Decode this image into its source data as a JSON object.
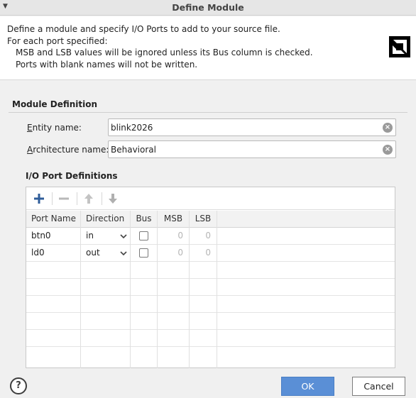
{
  "window": {
    "title": "Define Module"
  },
  "header": {
    "line1": "Define a module and specify I/O Ports to add to your source file.",
    "line2": "For each port specified:",
    "line3": "MSB and LSB values will be ignored unless its Bus column is checked.",
    "line4": "Ports with blank names will not be written.",
    "logo_icon": "amd-logo-icon"
  },
  "module_definition": {
    "section_title": "Module Definition",
    "entity_label_mnemonic": "E",
    "entity_label_rest": "ntity name:",
    "entity_value": "blink2026",
    "arch_label_mnemonic": "A",
    "arch_label_rest": "rchitecture name:",
    "arch_value": "Behavioral"
  },
  "io_ports": {
    "section_title": "I/O Port Definitions",
    "toolbar": {
      "add_icon": "plus-icon",
      "remove_icon": "minus-icon",
      "move_up_icon": "arrow-up-icon",
      "move_down_icon": "arrow-down-icon"
    },
    "columns": [
      "Port Name",
      "Direction",
      "Bus",
      "MSB",
      "LSB"
    ],
    "rows": [
      {
        "name": "btn0",
        "direction": "in",
        "bus": false,
        "msb": "0",
        "lsb": "0"
      },
      {
        "name": "ld0",
        "direction": "out",
        "bus": false,
        "msb": "0",
        "lsb": "0"
      }
    ]
  },
  "buttons": {
    "help": "?",
    "ok": "OK",
    "cancel": "Cancel"
  },
  "colors": {
    "accent": "#5a8fd6",
    "add_icon": "#2f5d9a"
  }
}
